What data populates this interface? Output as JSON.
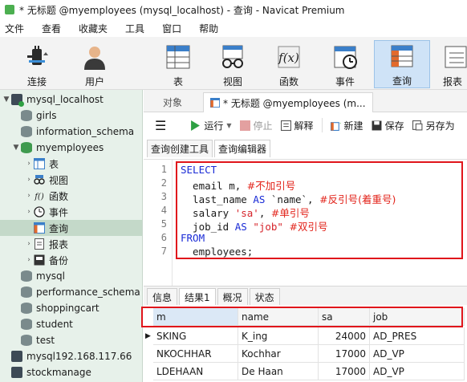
{
  "window": {
    "title": "* 无标题 @myemployees (mysql_localhost) - 查询 - Navicat Premium"
  },
  "menu": [
    "文件",
    "查看",
    "收藏夹",
    "工具",
    "窗口",
    "帮助"
  ],
  "toolbar": {
    "connect": "连接",
    "user": "用户",
    "table": "表",
    "view": "视图",
    "function": "函数",
    "event": "事件",
    "query": "查询",
    "report": "报表"
  },
  "sidebar": {
    "items": [
      {
        "label": "mysql_localhost",
        "level": 0,
        "type": "server",
        "expanded": true
      },
      {
        "label": "girls",
        "level": 1,
        "type": "db"
      },
      {
        "label": "information_schema",
        "level": 1,
        "type": "db"
      },
      {
        "label": "myemployees",
        "level": 1,
        "type": "db",
        "expanded": true
      },
      {
        "label": "表",
        "level": 2,
        "type": "table",
        "collapsed": true
      },
      {
        "label": "视图",
        "level": 2,
        "type": "view",
        "collapsed": true
      },
      {
        "label": "函数",
        "level": 2,
        "type": "function",
        "collapsed": true
      },
      {
        "label": "事件",
        "level": 2,
        "type": "event",
        "collapsed": true
      },
      {
        "label": "查询",
        "level": 2,
        "type": "query",
        "selected": true
      },
      {
        "label": "报表",
        "level": 2,
        "type": "report",
        "collapsed": true
      },
      {
        "label": "备份",
        "level": 2,
        "type": "backup",
        "collapsed": true
      },
      {
        "label": "mysql",
        "level": 1,
        "type": "db"
      },
      {
        "label": "performance_schema",
        "level": 1,
        "type": "db"
      },
      {
        "label": "shoppingcart",
        "level": 1,
        "type": "db"
      },
      {
        "label": "student",
        "level": 1,
        "type": "db"
      },
      {
        "label": "test",
        "level": 1,
        "type": "db"
      },
      {
        "label": "mysql192.168.117.66",
        "level": 0,
        "type": "server-off"
      },
      {
        "label": "stockmanage",
        "level": 0,
        "type": "server-off"
      }
    ]
  },
  "tabs": {
    "objects": "对象",
    "query_tab": "* 无标题 @myemployees (m..."
  },
  "query_toolbar": {
    "run": "运行",
    "stop": "停止",
    "explain": "解释",
    "new": "新建",
    "save": "保存",
    "save_as": "另存为"
  },
  "subtabs": {
    "builder": "查询创建工具",
    "editor": "查询编辑器"
  },
  "editor": {
    "line_numbers": [
      "1",
      "2",
      "3",
      "4",
      "5",
      "6",
      "7"
    ],
    "l1_kw": "SELECT",
    "l2_code": "  email m, ",
    "l2_cmt": "#不加引号",
    "l3_code_a": "  last_name ",
    "l3_kw": "AS",
    "l3_code_b": " `name`, ",
    "l3_cmt": "#反引号(着重号)",
    "l4_code_a": "  salary ",
    "l4_str": "'sa'",
    "l4_code_b": ", ",
    "l4_cmt": "#单引号",
    "l5_code_a": "  job_id ",
    "l5_kw": "AS",
    "l5_str": " \"job\"",
    "l5_code_b": " ",
    "l5_cmt": "#双引号",
    "l6_kw": "FROM",
    "l7_code": "  employees;"
  },
  "result_tabs": [
    "信息",
    "结果1",
    "概况",
    "状态"
  ],
  "grid": {
    "columns": [
      "m",
      "name",
      "sa",
      "job"
    ],
    "rows": [
      [
        "SKING",
        "K_ing",
        "24000",
        "AD_PRES"
      ],
      [
        "NKOCHHAR",
        "Kochhar",
        "17000",
        "AD_VP"
      ],
      [
        "LDEHAAN",
        "De Haan",
        "17000",
        "AD_VP"
      ]
    ]
  },
  "colors": {
    "accent": "#e0151b",
    "keyword": "#1a2bd6",
    "sidebar_bg": "#e7f1ea"
  }
}
